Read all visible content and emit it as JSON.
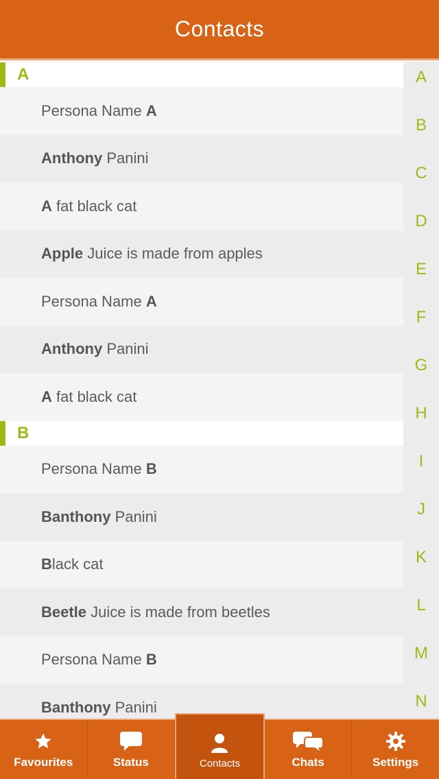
{
  "header": {
    "title": "Contacts"
  },
  "sections": [
    {
      "letter": "A",
      "rows": [
        {
          "pre": "Persona Name ",
          "bold": "A",
          "post": ""
        },
        {
          "pre": "",
          "bold": "Anthony",
          "post": " Panini"
        },
        {
          "pre": "",
          "bold": "A",
          "post": " fat black cat"
        },
        {
          "pre": "",
          "bold": "Apple",
          "post": " Juice is made from apples"
        },
        {
          "pre": "Persona Name ",
          "bold": "A",
          "post": ""
        },
        {
          "pre": "",
          "bold": "Anthony",
          "post": " Panini"
        },
        {
          "pre": "",
          "bold": "A",
          "post": " fat black cat"
        }
      ]
    },
    {
      "letter": "B",
      "rows": [
        {
          "pre": "Persona Name ",
          "bold": "B",
          "post": ""
        },
        {
          "pre": "",
          "bold": "Banthony",
          "post": " Panini"
        },
        {
          "pre": "",
          "bold": "B",
          "post": "lack cat"
        },
        {
          "pre": "",
          "bold": "Beetle",
          "post": " Juice is made from beetles"
        },
        {
          "pre": "Persona Name ",
          "bold": "B",
          "post": ""
        },
        {
          "pre": "",
          "bold": "Banthony",
          "post": " Panini"
        }
      ]
    }
  ],
  "index_letters": [
    "A",
    "B",
    "C",
    "D",
    "E",
    "F",
    "G",
    "H",
    "I",
    "J",
    "K",
    "L",
    "M",
    "N"
  ],
  "tabs": [
    {
      "label": "Favourites",
      "icon": "star-icon",
      "active": false
    },
    {
      "label": "Status",
      "icon": "speech-bubble-icon",
      "active": false
    },
    {
      "label": "Contacts",
      "icon": "person-icon",
      "active": true
    },
    {
      "label": "Chats",
      "icon": "chat-bubbles-icon",
      "active": false
    },
    {
      "label": "Settings",
      "icon": "gear-icon",
      "active": false
    }
  ],
  "colors": {
    "brand_orange": "#d86216",
    "accent_green": "#9cbb17"
  }
}
